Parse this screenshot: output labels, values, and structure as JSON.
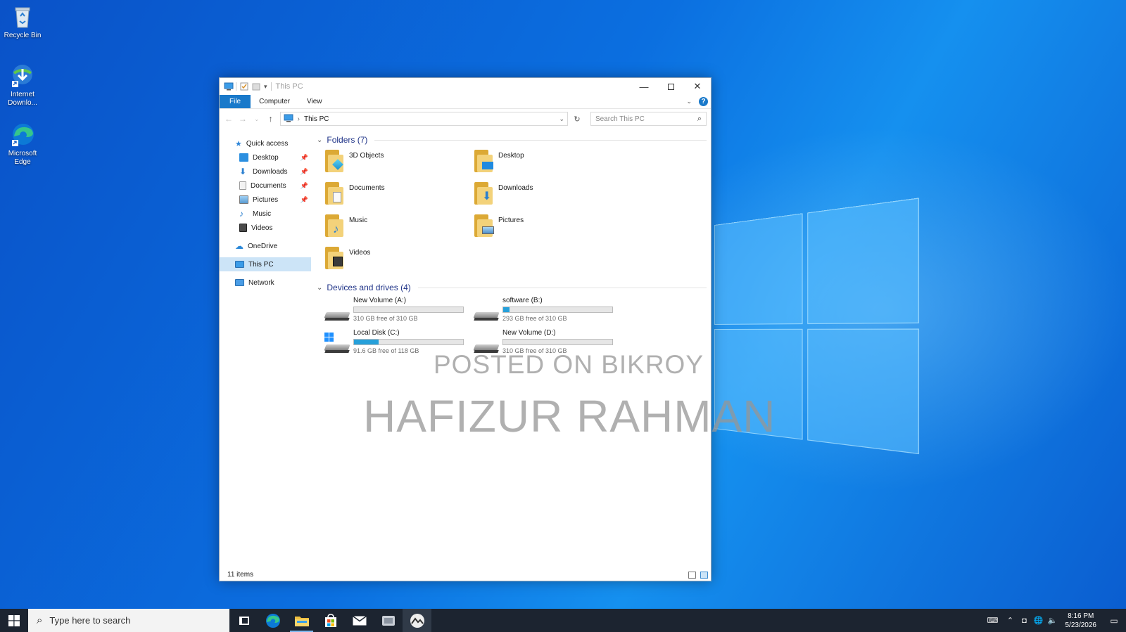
{
  "desktop": {
    "icons": [
      {
        "label": "Recycle Bin",
        "icon": "recycle-bin-icon"
      },
      {
        "label": "Internet Downlo...",
        "icon": "internet-download-manager-icon"
      },
      {
        "label": "Microsoft Edge",
        "icon": "edge-icon"
      }
    ],
    "watermark_line1": "POSTED ON BIKROY",
    "watermark_line2": "HAFIZUR RAHMAN"
  },
  "window": {
    "title": "This PC",
    "ribbon": {
      "file": "File",
      "computer": "Computer",
      "view": "View",
      "help": "?"
    },
    "address": {
      "path": "This PC",
      "search_placeholder": "Search This PC"
    },
    "nav": {
      "quick_access": "Quick access",
      "quick_items": [
        {
          "label": "Desktop",
          "pinned": true
        },
        {
          "label": "Downloads",
          "pinned": true
        },
        {
          "label": "Documents",
          "pinned": true
        },
        {
          "label": "Pictures",
          "pinned": true
        },
        {
          "label": "Music",
          "pinned": false
        },
        {
          "label": "Videos",
          "pinned": false
        }
      ],
      "onedrive": "OneDrive",
      "this_pc": "This PC",
      "network": "Network"
    },
    "folders_header": "Folders (7)",
    "folders": [
      "3D Objects",
      "Desktop",
      "Documents",
      "Downloads",
      "Music",
      "Pictures",
      "Videos"
    ],
    "drives_header": "Devices and drives (4)",
    "drives": [
      {
        "name": "New Volume (A:)",
        "free": "310 GB free of 310 GB",
        "used_fraction": 0.0
      },
      {
        "name": "software (B:)",
        "free": "293 GB free of 310 GB",
        "used_fraction": 0.055
      },
      {
        "name": "Local Disk (C:)",
        "free": "91.6 GB free of 118 GB",
        "used_fraction": 0.224
      },
      {
        "name": "New Volume (D:)",
        "free": "310 GB free of 310 GB",
        "used_fraction": 0.0
      }
    ],
    "status": "11 items"
  },
  "taskbar": {
    "search_placeholder": "Type here to search",
    "time": "8:16 PM",
    "date": "5/23/2026"
  },
  "colors": {
    "accent": "#1979ca",
    "drive_fill": "#26a0da",
    "folder_header": "#1e3287",
    "taskbar": "#1c2430"
  }
}
